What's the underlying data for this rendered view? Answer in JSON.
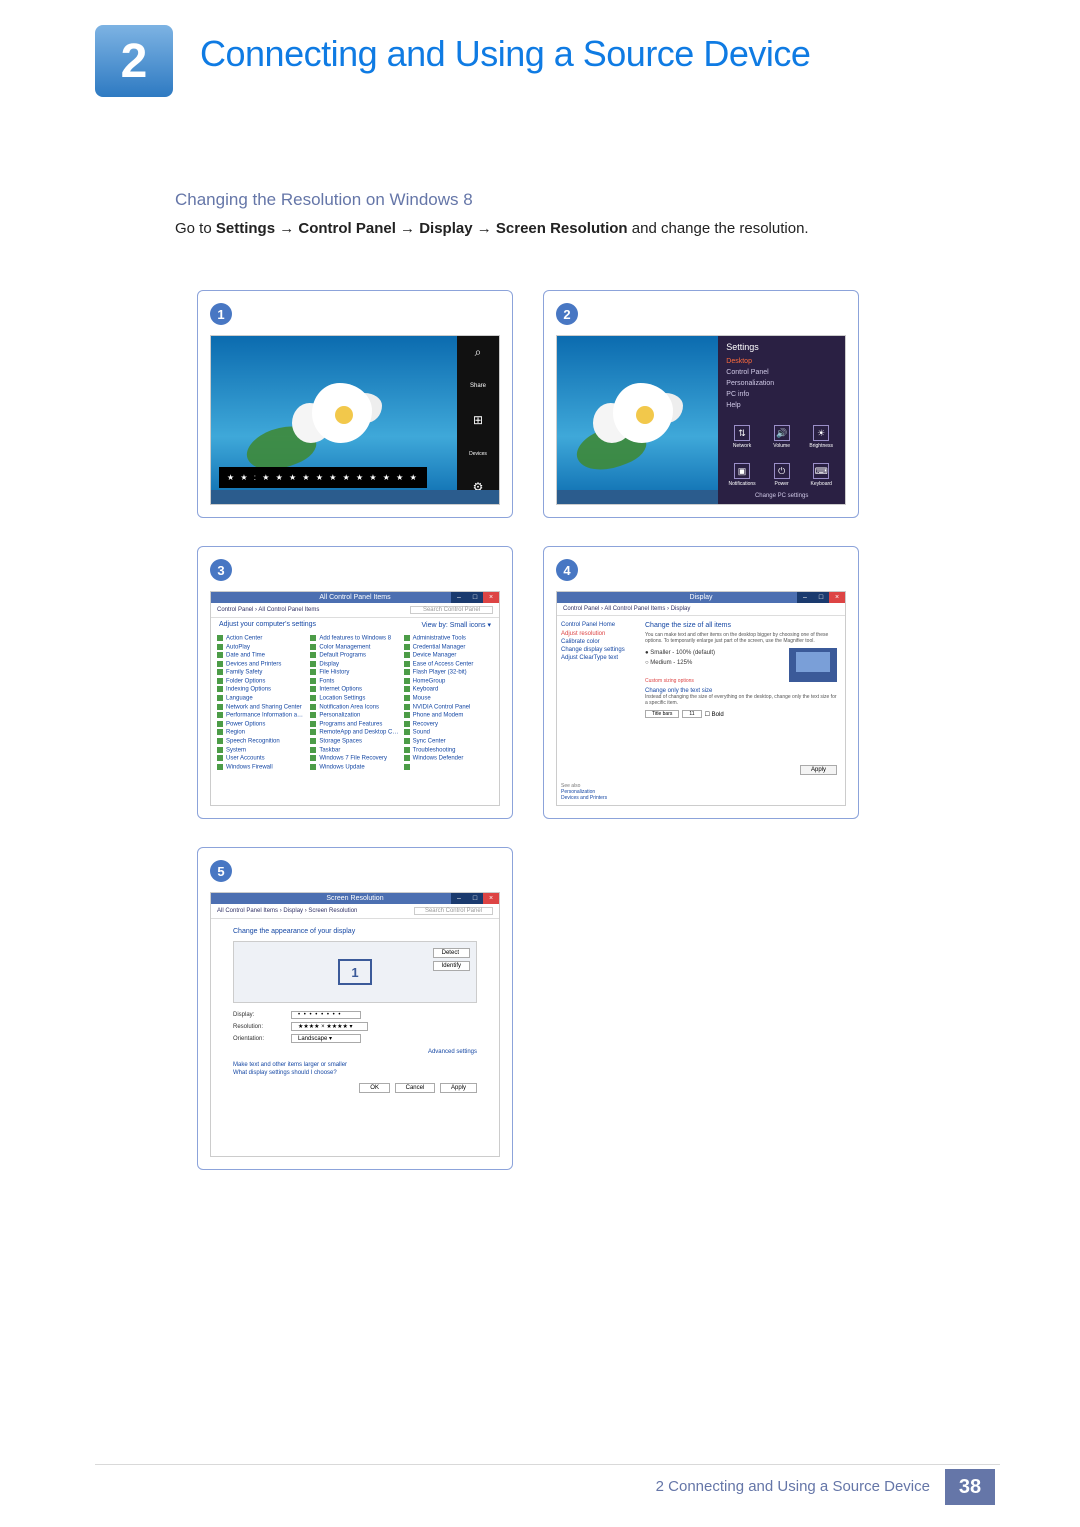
{
  "chapter_number": "2",
  "chapter_title": "Connecting and Using a Source Device",
  "subheading": "Changing the Resolution on Windows 8",
  "instruction_prefix": "Go to ",
  "instruction_path": "Settings → Control Panel → Display → Screen Resolution",
  "instruction_suffix": " and change the resolution.",
  "steps": [
    "1",
    "2",
    "3",
    "4",
    "5"
  ],
  "step1": {
    "time_overlay": "★ ★ : ★ ★   ★ ★ ★ ★\n                   ★ ★ ★ ★  ★ ★",
    "charms": [
      "⌕",
      "Share",
      "⊞",
      "Devices",
      "⚙"
    ]
  },
  "step2": {
    "pane_title": "Settings",
    "items": [
      "Desktop",
      "Control Panel",
      "Personalization",
      "PC info",
      "Help"
    ],
    "icons": [
      {
        "glyph": "⇅",
        "label": "Network"
      },
      {
        "glyph": "🔊",
        "label": "Volume"
      },
      {
        "glyph": "☀",
        "label": "Brightness"
      },
      {
        "glyph": "▣",
        "label": "Notifications"
      },
      {
        "glyph": "⏻",
        "label": "Power"
      },
      {
        "glyph": "⌨",
        "label": "Keyboard"
      }
    ],
    "change_link": "Change PC settings"
  },
  "step3": {
    "title": "All Control Panel Items",
    "breadcrumb": "Control Panel  ›  All Control Panel Items",
    "search_ph": "Search Control Panel",
    "adjust": "Adjust your computer's settings",
    "view": "View by:  Small icons ▾",
    "items": [
      "Action Center",
      "Add features to Windows 8",
      "Administrative Tools",
      "AutoPlay",
      "Color Management",
      "Credential Manager",
      "Date and Time",
      "Default Programs",
      "Device Manager",
      "Devices and Printers",
      "Display",
      "Ease of Access Center",
      "Family Safety",
      "File History",
      "Flash Player (32-bit)",
      "Folder Options",
      "Fonts",
      "HomeGroup",
      "Indexing Options",
      "Internet Options",
      "Keyboard",
      "Language",
      "Location Settings",
      "Mouse",
      "Network and Sharing Center",
      "Notification Area Icons",
      "NVIDIA Control Panel",
      "Performance Information and Tools",
      "Personalization",
      "Phone and Modem",
      "Power Options",
      "Programs and Features",
      "Recovery",
      "Region",
      "RemoteApp and Desktop Connections",
      "Sound",
      "Speech Recognition",
      "Storage Spaces",
      "Sync Center",
      "System",
      "Taskbar",
      "Troubleshooting",
      "User Accounts",
      "Windows 7 File Recovery",
      "Windows Defender",
      "Windows Firewall",
      "Windows Update",
      ""
    ]
  },
  "step4": {
    "title": "Display",
    "breadcrumb": "Control Panel  ›  All Control Panel Items  ›  Display",
    "side_home": "Control Panel Home",
    "side_links": [
      "Adjust resolution",
      "Calibrate color",
      "Change display settings",
      "Adjust ClearType text"
    ],
    "heading": "Change the size of all items",
    "desc": "You can make text and other items on the desktop bigger by choosing one of these options. To temporarily enlarge just part of the screen, use the Magnifier tool.",
    "opt1": "● Smaller - 100% (default)",
    "opt2": "○ Medium - 125%",
    "custom": "Custom sizing options",
    "heading2": "Change only the text size",
    "desc2": "Instead of changing the size of everything on the desktop, change only the text size for a specific item.",
    "select_label": "Title bars",
    "select_size": "11",
    "bold": "Bold",
    "apply": "Apply",
    "see_also": "See also",
    "also_links": [
      "Personalization",
      "Devices and Printers"
    ]
  },
  "step5": {
    "title": "Screen Resolution",
    "breadcrumb": "All Control Panel Items  ›  Display  ›  Screen Resolution",
    "search_ph": "Search Control Panel",
    "heading": "Change the appearance of your display",
    "detect": "Detect",
    "identify": "Identify",
    "monitor_num": "1",
    "display_lbl": "Display:",
    "display_val": "• • • • • • • •",
    "resolution_lbl": "Resolution:",
    "resolution_val": "★★★★ × ★★★★ ▾",
    "orientation_lbl": "Orientation:",
    "orientation_val": "Landscape ▾",
    "adv": "Advanced settings",
    "link1": "Make text and other items larger or smaller",
    "link2": "What display settings should I choose?",
    "ok": "OK",
    "cancel": "Cancel",
    "apply": "Apply"
  },
  "footer": {
    "text": "2 Connecting and Using a Source Device",
    "page": "38"
  }
}
